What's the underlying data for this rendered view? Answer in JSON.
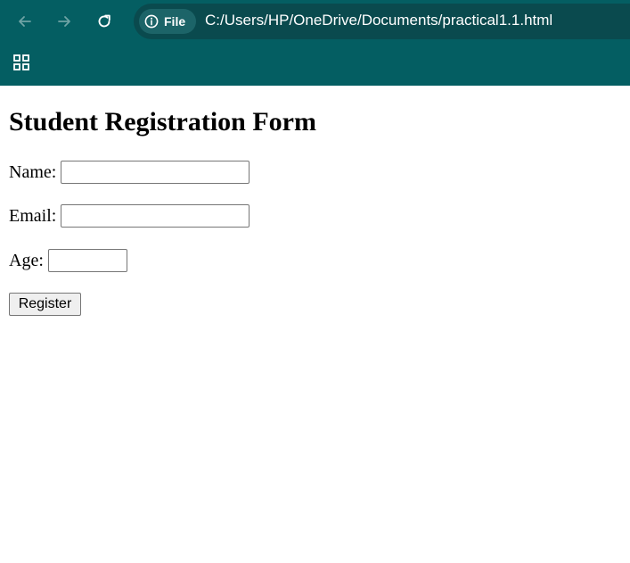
{
  "browser": {
    "nav": {
      "back_icon": "arrow-left-icon",
      "forward_icon": "arrow-right-icon",
      "reload_icon": "reload-icon"
    },
    "address_bar": {
      "site_info_icon": "info-icon",
      "site_info_label": "File",
      "url": "C:/Users/HP/OneDrive/Documents/practical1.1.html"
    },
    "apps_icon": "grid-icon",
    "colors": {
      "toolbar": "#045e62",
      "address_bar": "#0a4a4e",
      "site_chip": "#1c6468"
    }
  },
  "page": {
    "title": "Student Registration Form",
    "fields": {
      "name": {
        "label": "Name:",
        "value": ""
      },
      "email": {
        "label": "Email:",
        "value": ""
      },
      "age": {
        "label": "Age:",
        "value": ""
      }
    },
    "register_label": "Register"
  }
}
